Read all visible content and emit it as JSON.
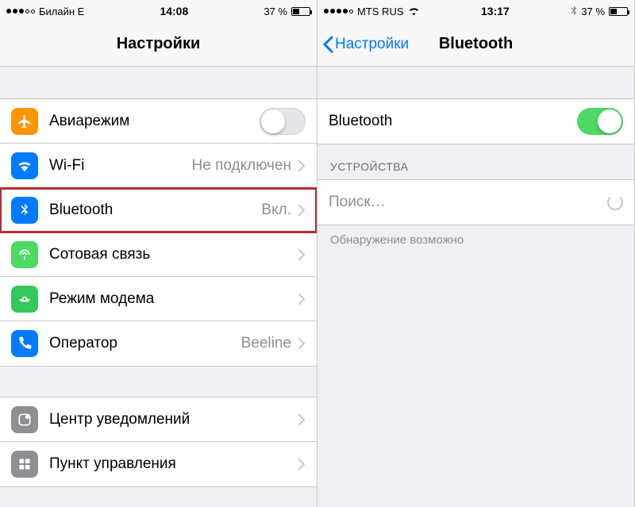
{
  "left": {
    "status": {
      "carrier": "Билайн  E",
      "time": "14:08",
      "battery": "37 %"
    },
    "header": {
      "title": "Настройки"
    },
    "rows": {
      "airplane": {
        "label": "Авиарежим"
      },
      "wifi": {
        "label": "Wi-Fi",
        "value": "Не подключен"
      },
      "bluetooth": {
        "label": "Bluetooth",
        "value": "Вкл."
      },
      "cellular": {
        "label": "Сотовая связь"
      },
      "hotspot": {
        "label": "Режим модема"
      },
      "carrier": {
        "label": "Оператор",
        "value": "Beeline"
      },
      "notifications": {
        "label": "Центр уведомлений"
      },
      "control": {
        "label": "Пункт управления"
      }
    }
  },
  "right": {
    "status": {
      "carrier": "MTS RUS",
      "time": "13:17",
      "battery": "37 %"
    },
    "header": {
      "back": "Настройки",
      "title": "Bluetooth"
    },
    "rows": {
      "bt": {
        "label": "Bluetooth"
      },
      "search": {
        "label": "Поиск…"
      }
    },
    "section_devices": "УСТРОЙСТВА",
    "footer": "Обнаружение возможно"
  }
}
